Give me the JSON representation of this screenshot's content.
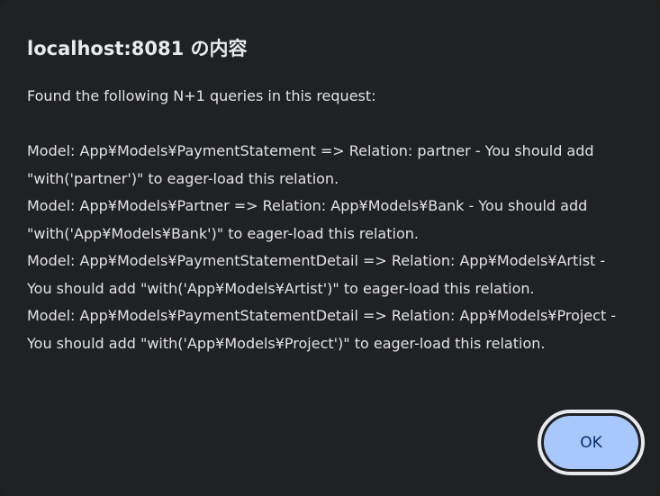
{
  "dialog": {
    "title": "localhost:8081 の内容",
    "intro": "Found the following N+1 queries in this request:",
    "lines": [
      "Model: App¥Models¥PaymentStatement => Relation: partner - You should add",
      "\"with('partner')\" to eager-load this relation.",
      "Model: App¥Models¥Partner => Relation: App¥Models¥Bank - You should add",
      "\"with('App¥Models¥Bank')\" to eager-load this relation.",
      "Model: App¥Models¥PaymentStatementDetail => Relation: App¥Models¥Artist -",
      "You should add \"with('App¥Models¥Artist')\" to eager-load this relation.",
      "Model: App¥Models¥PaymentStatementDetail => Relation: App¥Models¥Project -",
      "You should add \"with('App¥Models¥Project')\" to eager-load this relation."
    ],
    "ok_label": "OK"
  },
  "colors": {
    "background": "#202124",
    "text": "#e3e3e3",
    "button_fill": "#a8c7fa",
    "button_text": "#062e6f",
    "focus_ring": "#e8eaed"
  }
}
